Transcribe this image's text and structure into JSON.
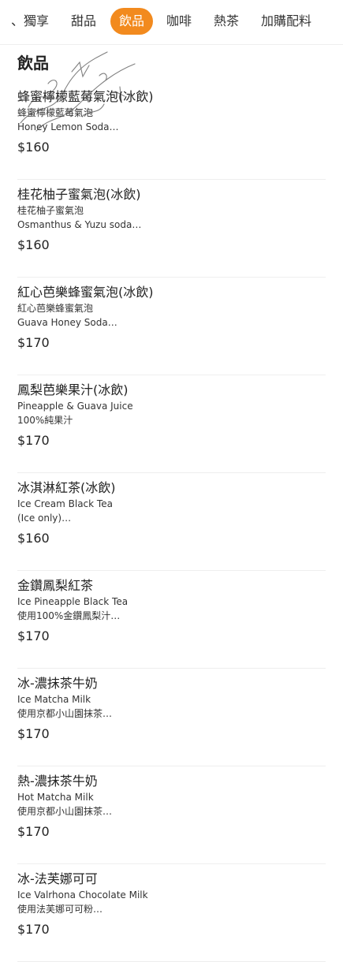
{
  "tabs": [
    {
      "label": "、獨享",
      "active": false
    },
    {
      "label": "甜品",
      "active": false
    },
    {
      "label": "飲品",
      "active": true
    },
    {
      "label": "咖啡",
      "active": false
    },
    {
      "label": "熱茶",
      "active": false
    },
    {
      "label": "加購配料",
      "active": false
    }
  ],
  "accent_color": "#f28a1e",
  "section_title": "飲品",
  "items": [
    {
      "name": "蜂蜜檸檬藍莓氣泡(冰飲)",
      "desc1": "蜂蜜檸檬藍莓氣泡",
      "desc2": "Honey Lemon Soda…",
      "price": "$160"
    },
    {
      "name": "桂花柚子蜜氣泡(冰飲)",
      "desc1": "桂花柚子蜜氣泡",
      "desc2": "Osmanthus & Yuzu soda…",
      "price": "$160"
    },
    {
      "name": "紅心芭樂蜂蜜氣泡(冰飲)",
      "desc1": "紅心芭樂蜂蜜氣泡",
      "desc2": "Guava Honey Soda…",
      "price": "$170"
    },
    {
      "name": "鳳梨芭樂果汁(冰飲)",
      "desc1": "Pineapple & Guava Juice",
      "desc2": "100%純果汁",
      "price": "$170"
    },
    {
      "name": "冰淇淋紅茶(冰飲)",
      "desc1": "Ice Cream Black Tea",
      "desc2": "(Ice only)…",
      "price": "$160"
    },
    {
      "name": "金鑽鳳梨紅茶",
      "desc1": "Ice Pineapple Black Tea",
      "desc2": "使用100%金鑽鳳梨汁…",
      "price": "$170"
    },
    {
      "name": "冰-濃抹茶牛奶",
      "desc1": "Ice Matcha Milk",
      "desc2": "使用京都小山園抹茶…",
      "price": "$170"
    },
    {
      "name": "熱-濃抹茶牛奶",
      "desc1": "Hot Matcha Milk",
      "desc2": "使用京都小山園抹茶…",
      "price": "$170"
    },
    {
      "name": "冰-法芙娜可可",
      "desc1": "Ice Valrhona Chocolate Milk",
      "desc2": "使用法芙娜可可粉…",
      "price": "$170"
    }
  ]
}
